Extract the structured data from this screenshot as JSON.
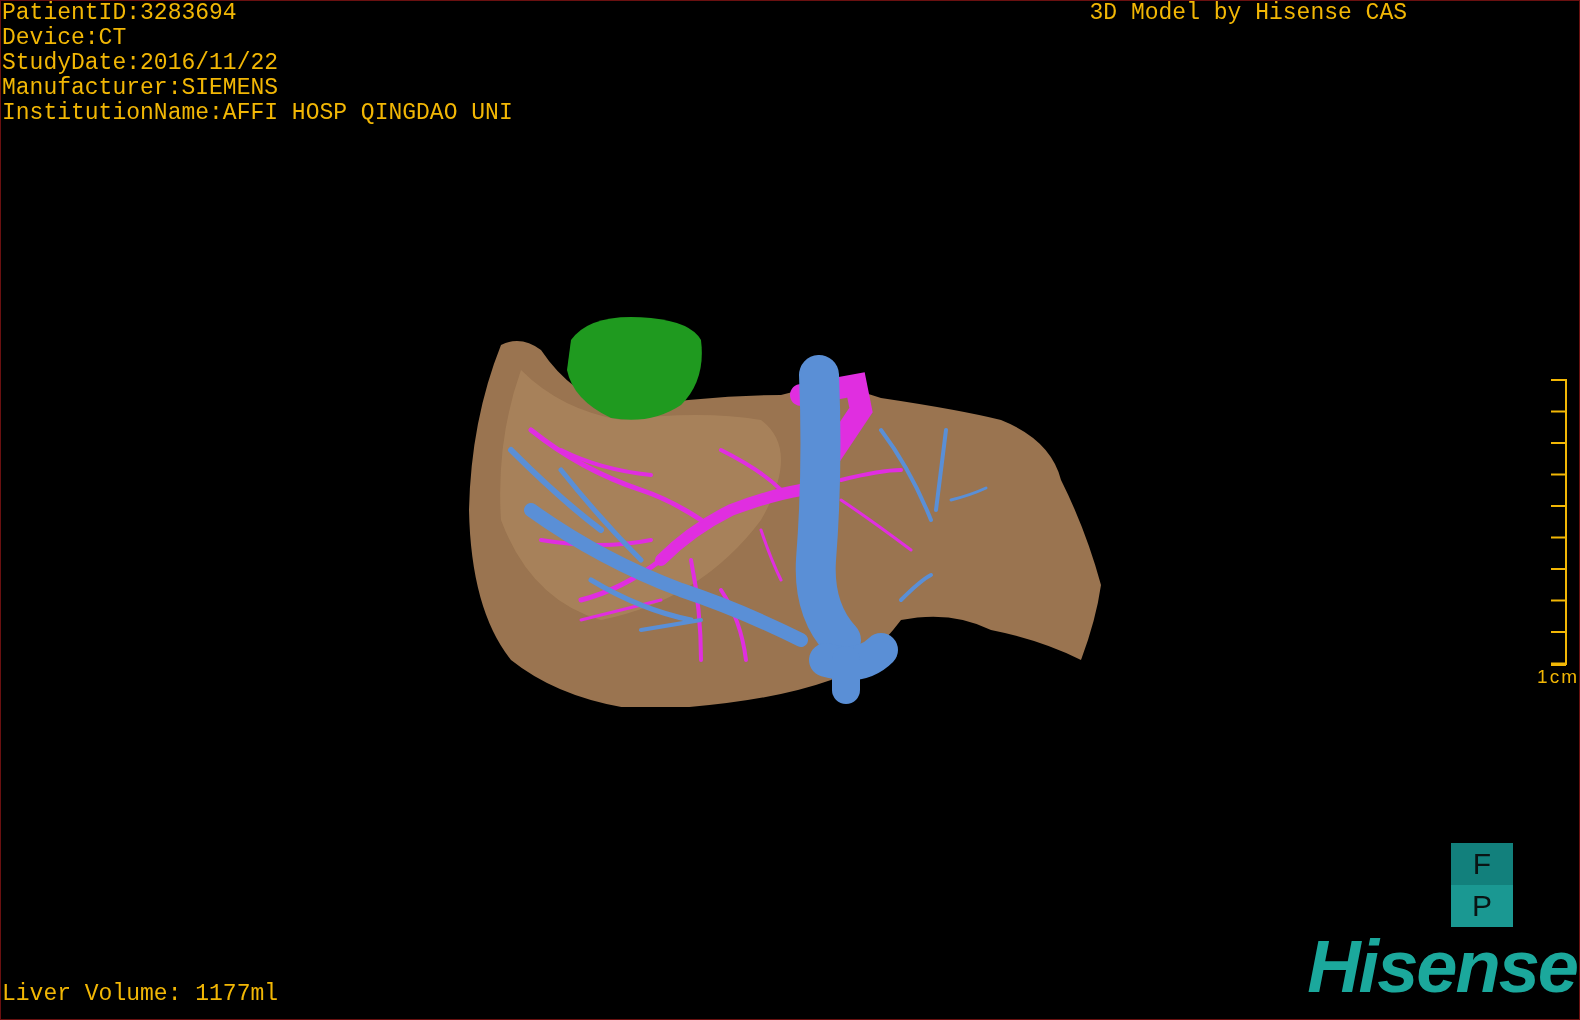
{
  "info_lines": [
    "PatientID:3283694",
    "Device:CT",
    "StudyDate:2016/11/22",
    "Manufacturer:SIEMENS",
    "InstitutionName:AFFI HOSP QINGDAO UNI"
  ],
  "title": "3D Model by Hisense CAS",
  "scale_bar": {
    "label": "1cm"
  },
  "orientation_cube": {
    "faces": [
      "F",
      "P"
    ]
  },
  "liver_volume": "Liver Volume: 1177ml",
  "logo": {
    "text": "Hisense"
  }
}
